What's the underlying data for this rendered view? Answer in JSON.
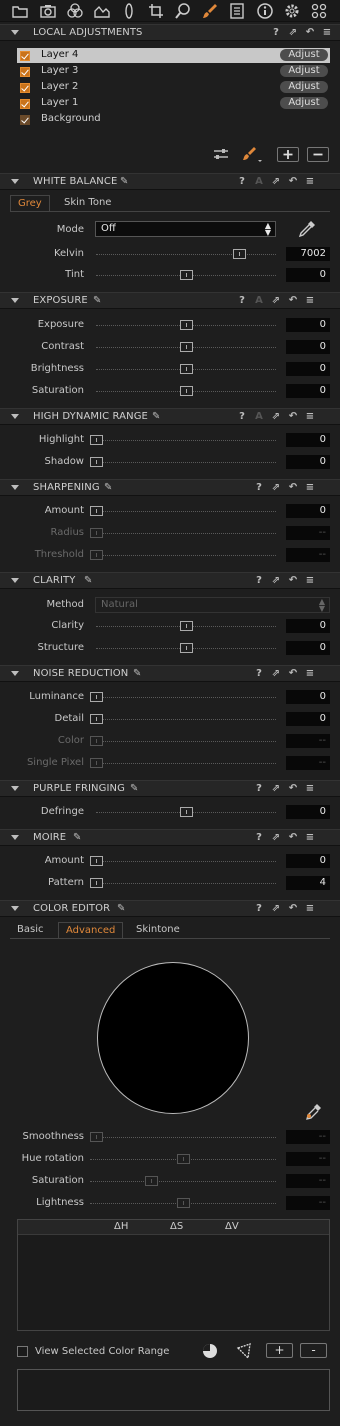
{
  "toolbar": {
    "icons": [
      "folder-icon",
      "camera-icon",
      "color-icon",
      "exposure-icon",
      "lens-icon",
      "crop-icon",
      "focus-icon",
      "local-adjustments-icon",
      "metadata-icon",
      "info-icon",
      "settings-icon",
      "batch-icon"
    ],
    "active_index": 7
  },
  "local_adjustments": {
    "title": "LOCAL ADJUSTMENTS",
    "layers": [
      {
        "name": "Layer 4",
        "button": "Adjust",
        "selected": true
      },
      {
        "name": "Layer 3",
        "button": "Adjust"
      },
      {
        "name": "Layer 2",
        "button": "Adjust"
      },
      {
        "name": "Layer 1",
        "button": "Adjust"
      },
      {
        "name": "Background"
      }
    ]
  },
  "white_balance": {
    "title": "WHITE BALANCE",
    "tabs": [
      "Grey",
      "Skin Tone"
    ],
    "mode_label": "Mode",
    "mode_value": "Off",
    "sliders": [
      {
        "label": "Kelvin",
        "value": "7002",
        "position": 0.82
      },
      {
        "label": "Tint",
        "value": "0",
        "position": 0.5
      }
    ]
  },
  "exposure": {
    "title": "EXPOSURE",
    "sliders": [
      {
        "label": "Exposure",
        "value": "0",
        "position": 0.5
      },
      {
        "label": "Contrast",
        "value": "0",
        "position": 0.5
      },
      {
        "label": "Brightness",
        "value": "0",
        "position": 0.5
      },
      {
        "label": "Saturation",
        "value": "0",
        "position": 0.5
      }
    ]
  },
  "hdr": {
    "title": "HIGH DYNAMIC RANGE",
    "sliders": [
      {
        "label": "Highlight",
        "value": "0",
        "position": 0.0
      },
      {
        "label": "Shadow",
        "value": "0",
        "position": 0.0
      }
    ]
  },
  "sharpening": {
    "title": "SHARPENING",
    "sliders": [
      {
        "label": "Amount",
        "value": "0",
        "position": 0.0
      },
      {
        "label": "Radius",
        "value": "--",
        "position": 0.0,
        "disabled": true
      },
      {
        "label": "Threshold",
        "value": "--",
        "position": 0.0,
        "disabled": true
      }
    ]
  },
  "clarity": {
    "title": "CLARITY",
    "method_label": "Method",
    "method_value": "Natural",
    "sliders": [
      {
        "label": "Clarity",
        "value": "0",
        "position": 0.5
      },
      {
        "label": "Structure",
        "value": "0",
        "position": 0.5
      }
    ]
  },
  "noise_reduction": {
    "title": "NOISE REDUCTION",
    "sliders": [
      {
        "label": "Luminance",
        "value": "0",
        "position": 0.0
      },
      {
        "label": "Detail",
        "value": "0",
        "position": 0.0
      },
      {
        "label": "Color",
        "value": "--",
        "position": 0.0,
        "disabled": true
      },
      {
        "label": "Single Pixel",
        "value": "--",
        "position": 0.0,
        "disabled": true
      }
    ]
  },
  "purple_fringing": {
    "title": "PURPLE FRINGING",
    "sliders": [
      {
        "label": "Defringe",
        "value": "0",
        "position": 0.5
      }
    ]
  },
  "moire": {
    "title": "MOIRE",
    "sliders": [
      {
        "label": "Amount",
        "value": "0",
        "position": 0.0
      },
      {
        "label": "Pattern",
        "value": "4",
        "position": 0.0
      }
    ]
  },
  "color_editor": {
    "title": "COLOR EDITOR",
    "tabs": [
      "Basic",
      "Advanced",
      "Skintone"
    ],
    "active_tab": 1,
    "sliders": [
      {
        "label": "Smoothness",
        "value": "--",
        "position": 0.0,
        "disabled": true
      },
      {
        "label": "Hue rotation",
        "value": "--",
        "position": 0.5,
        "disabled": true
      },
      {
        "label": "Saturation",
        "value": "--",
        "position": 0.32,
        "disabled": true
      },
      {
        "label": "Lightness",
        "value": "--",
        "position": 0.5,
        "disabled": true
      }
    ],
    "table_headers": [
      "ΔH",
      "ΔS",
      "ΔV"
    ],
    "view_range_label": "View Selected Color Range",
    "add_label": "+",
    "remove_label": "-"
  },
  "colors": {
    "accent": "#e0883a",
    "panel": "#1e1e1e",
    "header": "#262626"
  }
}
